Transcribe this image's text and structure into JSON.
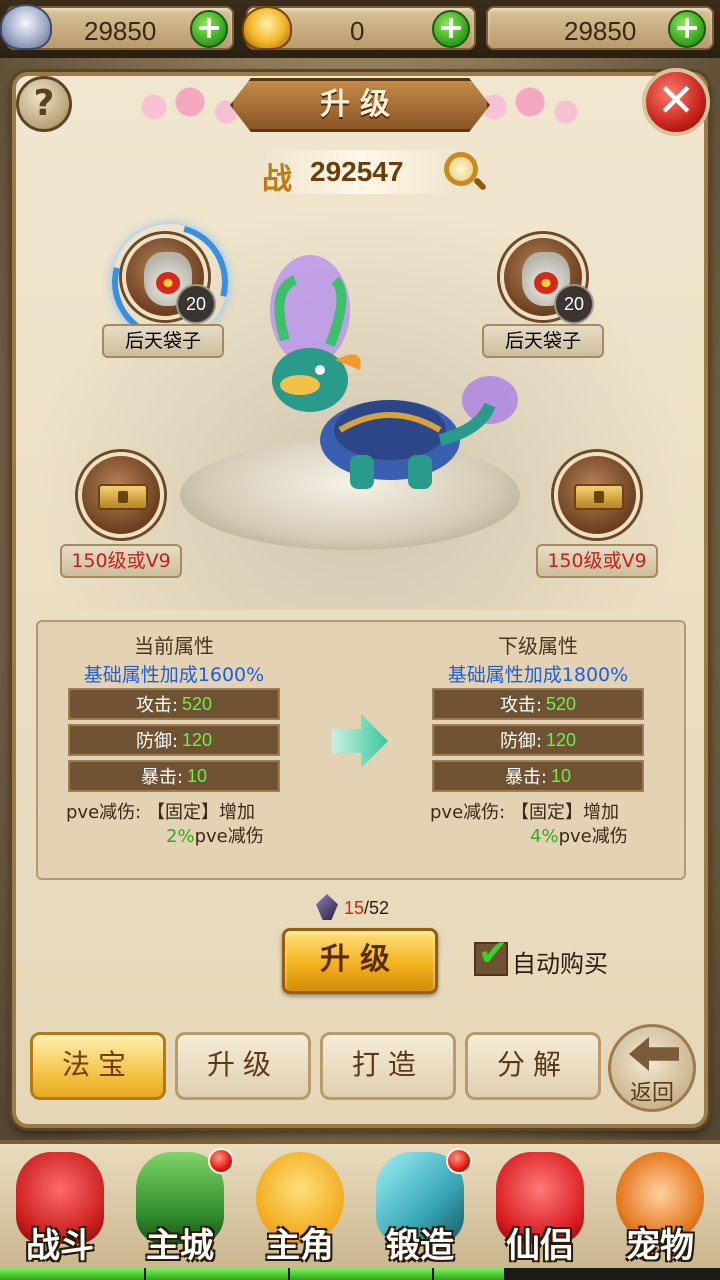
{
  "resources": {
    "silver": "29850",
    "gold": "0",
    "third": "29850",
    "add_label": "+"
  },
  "panel": {
    "title": "升级",
    "help_label": "?",
    "close_label": "✕"
  },
  "power": {
    "prefix": "战",
    "value": "292547"
  },
  "slots": {
    "left_top": {
      "count": "20",
      "label": "后天袋子"
    },
    "right_top": {
      "count": "20",
      "label": "后天袋子"
    },
    "left_bottom": {
      "label": "150级或V9"
    },
    "right_bottom": {
      "label": "150级或V9"
    }
  },
  "attributes": {
    "current": {
      "heading": "当前属性",
      "bonus": "基础属性加成1600%",
      "attack_label": "攻击:",
      "attack_value": "520",
      "defense_label": "防御:",
      "defense_value": "120",
      "crit_label": "暴击:",
      "crit_value": "10",
      "pve_line1": "pve减伤: 【固定】增加",
      "pve_pct": "2%",
      "pve_suffix": "pve减伤"
    },
    "next": {
      "heading": "下级属性",
      "bonus": "基础属性加成1800%",
      "attack_label": "攻击:",
      "attack_value": "520",
      "defense_label": "防御:",
      "defense_value": "120",
      "crit_label": "暴击:",
      "crit_value": "10",
      "pve_line1": "pve减伤: 【固定】增加",
      "pve_pct": "4%",
      "pve_suffix": "pve减伤"
    }
  },
  "cost": {
    "have": "15",
    "need": "/52"
  },
  "upgrade_button": "升级",
  "auto_buy": {
    "label": "自动购买",
    "checked": true,
    "check_glyph": "✔"
  },
  "tabs": [
    {
      "label": "法宝",
      "active": true
    },
    {
      "label": "升级",
      "active": false
    },
    {
      "label": "打造",
      "active": false
    },
    {
      "label": "分解",
      "active": false
    }
  ],
  "back_label": "返回",
  "nav": [
    {
      "label": "战斗",
      "icon": "red-ninja-icon",
      "color": "#e23a3a",
      "badge": false
    },
    {
      "label": "主城",
      "icon": "city-gate-icon",
      "color": "#3f9a3a",
      "badge": true
    },
    {
      "label": "主角",
      "icon": "hero-face-icon",
      "color": "#f2b22a",
      "badge": false
    },
    {
      "label": "锻造",
      "icon": "hammer-icon",
      "color": "#3fb0c0",
      "badge": true
    },
    {
      "label": "仙侣",
      "icon": "heart-icon",
      "color": "#e2282e",
      "badge": false
    },
    {
      "label": "宠物",
      "icon": "monkey-icon",
      "color": "#e47a1a",
      "badge": false
    }
  ],
  "xp_progress": 0.7
}
